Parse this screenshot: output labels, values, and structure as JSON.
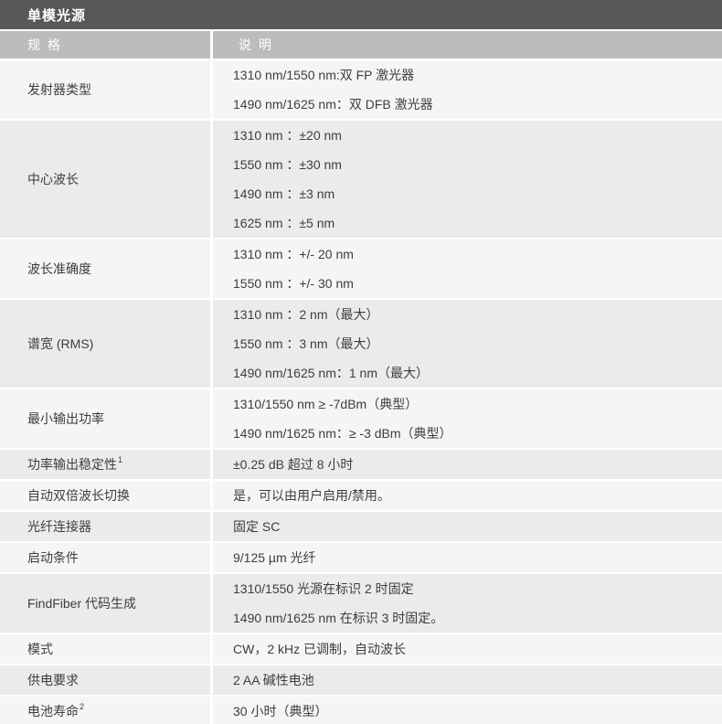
{
  "title": "单模光源",
  "colors": {
    "title_bar_bg": "#58585a",
    "header_bg": "#bcbcbc",
    "row_light_bg": "#f5f5f5",
    "row_dark_bg": "#ebebeb",
    "text": "#3d3d3d",
    "header_text": "#ffffff"
  },
  "header": {
    "spec": "规 格",
    "desc": "说 明"
  },
  "rows": [
    {
      "spec": "发射器类型",
      "desc": [
        "1310 nm/1550 nm:双 FP 激光器",
        "1490 nm/1625 nm：双 DFB 激光器"
      ]
    },
    {
      "spec": "中心波长",
      "desc": [
        "1310 nm ：±20 nm",
        "1550 nm ：±30 nm",
        "1490 nm ：±3 nm",
        "1625 nm ：±5 nm"
      ]
    },
    {
      "spec": "波长准确度",
      "desc": [
        "1310 nm ：+/- 20 nm",
        "1550 nm ：+/- 30 nm"
      ]
    },
    {
      "spec": "谱宽 (RMS)",
      "desc": [
        "1310 nm ：2 nm（最大）",
        "1550 nm ：3 nm（最大）",
        "1490 nm/1625 nm：1 nm（最大）"
      ]
    },
    {
      "spec": "最小输出功率",
      "desc": [
        "1310/1550 nm ≥ -7dBm（典型）",
        "1490 nm/1625 nm：≥ -3 dBm（典型）"
      ]
    },
    {
      "spec": "功率输出稳定性",
      "sup": "1",
      "desc": [
        "±0.25 dB 超过 8 小时"
      ]
    },
    {
      "spec": "自动双倍波长切换",
      "desc": [
        "是，可以由用户启用/禁用。"
      ]
    },
    {
      "spec": "光纤连接器",
      "desc": [
        "固定 SC"
      ]
    },
    {
      "spec": "启动条件",
      "desc": [
        "9/125 µm 光纤"
      ]
    },
    {
      "spec": "FindFiber 代码生成",
      "desc": [
        "1310/1550 光源在标识 2 时固定",
        "1490 nm/1625 nm 在标识 3 时固定。"
      ]
    },
    {
      "spec": "模式",
      "desc": [
        "CW，2 kHz 已调制，自动波长"
      ]
    },
    {
      "spec": "供电要求",
      "desc": [
        "2 AA 碱性电池"
      ]
    },
    {
      "spec": "电池寿命",
      "sup": "2",
      "desc": [
        "30 小时（典型）"
      ]
    }
  ]
}
